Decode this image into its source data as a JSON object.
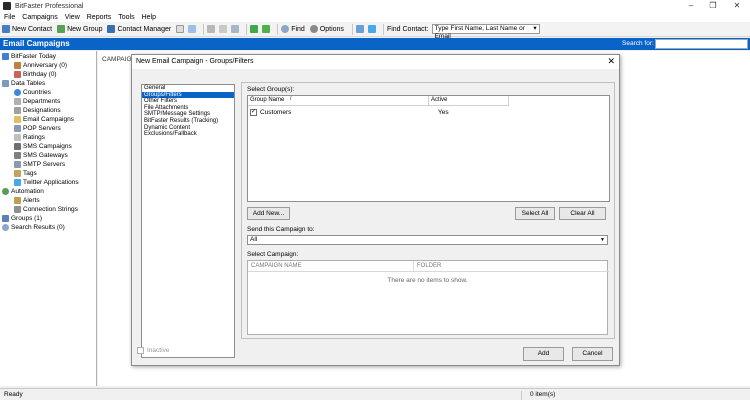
{
  "window": {
    "title": "BitFaster Professional"
  },
  "menu": [
    "File",
    "Campaigns",
    "View",
    "Reports",
    "Tools",
    "Help"
  ],
  "toolbar": {
    "new_contact": "New Contact",
    "new_group": "New Group",
    "contact_manager": "Contact Manager",
    "find": "Find",
    "options": "Options",
    "find_contact_label": "Find Contact:",
    "find_contact_value": "Type First Name, Last Name or Email"
  },
  "header": {
    "title": "Email Campaigns",
    "search_label": "Search for:"
  },
  "tree": {
    "bitfaster_today": "BitFaster Today",
    "anniversary": "Anniversary (0)",
    "birthday": "Birthday (0)",
    "data_tables": "Data Tables",
    "countries": "Countries",
    "departments": "Departments",
    "designations": "Designations",
    "email_campaigns": "Email Campaigns",
    "pop_servers": "POP Servers",
    "ratings": "Ratings",
    "sms_campaigns": "SMS Campaigns",
    "sms_gateways": "SMS Gateways",
    "smtp_servers": "SMTP Servers",
    "tags": "Tags",
    "twitter_applications": "Twitter Applications",
    "automation": "Automation",
    "alerts": "Alerts",
    "connection_strings": "Connection Strings",
    "groups": "Groups (1)",
    "search_results": "Search Results (0)"
  },
  "content": {
    "column_header": "CAMPAIG"
  },
  "dialog": {
    "title": "New Email Campaign - Groups/Filters",
    "nav": [
      "General",
      "Groups/Filters",
      "Other Filters",
      "File Attachments",
      "SMTP/Message Settings",
      "BitFaster Results (Tracking)",
      "Dynamic Content",
      "Exclusions/Fallback"
    ],
    "select_groups_label": "Select Group(s):",
    "group_col_name": "Group Name",
    "group_col_active": "Active",
    "group_rows": [
      {
        "name": "Customers",
        "active": "Yes",
        "checked": true
      }
    ],
    "add_new": "Add New...",
    "select_all": "Select All",
    "clear_all": "Clear All",
    "send_label": "Send this Campaign to:",
    "send_value": "All",
    "select_campaign_label": "Select Campaign:",
    "camp_col_name": "CAMPAIGN NAME",
    "camp_col_folder": "FOLDER",
    "camp_empty": "There are no items to show.",
    "inactive_label": "Inactive",
    "add_button": "Add",
    "cancel_button": "Cancel"
  },
  "status": {
    "left": "Ready",
    "right": "0 item(s)"
  },
  "colors": {
    "accent": "#0a64c8",
    "selection": "#0a64c8"
  }
}
